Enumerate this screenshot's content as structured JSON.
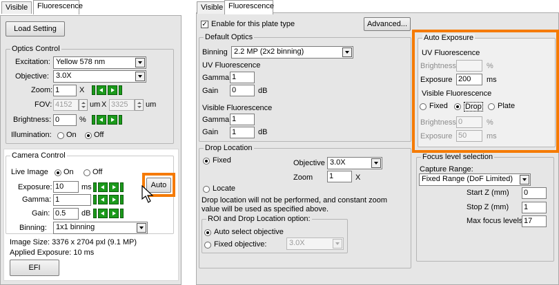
{
  "left": {
    "tabs": {
      "visible": "Visible",
      "fluorescence": "Fluorescence"
    },
    "load_setting": "Load Setting",
    "optics": {
      "title": "Optics Control",
      "excitation_label": "Excitation:",
      "excitation_value": "Yellow 578 nm",
      "objective_label": "Objective:",
      "objective_value": "3.0X",
      "zoom_label": "Zoom:",
      "zoom_value": "1",
      "zoom_unit": "X",
      "fov_label": "FOV:",
      "fov_w": "4152",
      "fov_unit1": "um",
      "fov_x": "X",
      "fov_h": "3325",
      "fov_unit2": "um",
      "brightness_label": "Brightness:",
      "brightness_value": "0",
      "brightness_unit": "%",
      "illumination_label": "Illumination:",
      "on": "On",
      "off": "Off"
    },
    "camera": {
      "title": "Camera Control",
      "live_label": "Live Image",
      "on": "On",
      "off": "Off",
      "exposure_label": "Exposure:",
      "exposure_value": "10",
      "exposure_unit": "ms",
      "auto": "Auto",
      "gamma_label": "Gamma:",
      "gamma_value": "1",
      "gain_label": "Gain:",
      "gain_value": "0.5",
      "gain_unit": "dB",
      "binning_label": "Binning:",
      "binning_value": "1x1 binning",
      "image_size": "Image Size:  3376 x 2704 pxl (9.1 MP)",
      "applied_exposure": "Applied Exposure: 10 ms",
      "efi": "EFI"
    }
  },
  "right": {
    "tabs": {
      "visible": "Visible",
      "fluorescence": "Fluorescence"
    },
    "enable_label": "Enable for this plate type",
    "advanced": "Advanced...",
    "default_optics": {
      "title": "Default Optics",
      "binning_label": "Binning",
      "binning_value": "2.2  MP (2x2 binning)",
      "uv_title": "UV Fluorescence",
      "uv_gamma_label": "Gamma",
      "uv_gamma": "1",
      "uv_gain_label": "Gain",
      "uv_gain": "0",
      "uv_gain_unit": "dB",
      "vis_title": "Visible Fluorescence",
      "vis_gamma_label": "Gamma",
      "vis_gamma": "1",
      "vis_gain_label": "Gain",
      "vis_gain": "1",
      "vis_gain_unit": "dB"
    },
    "auto_exposure": {
      "title": "Auto Exposure",
      "uv_title": "UV Fluorescence",
      "brightness_label": "Brightness",
      "brightness_unit": "%",
      "exposure_label": "Exposure",
      "exposure_value": "200",
      "exposure_unit": "ms",
      "vis_title": "Visible Fluorescence",
      "fixed": "Fixed",
      "drop": "Drop",
      "plate": "Plate",
      "vis_brightness_label": "Brightness",
      "vis_brightness": "0",
      "vis_brightness_unit": "%",
      "vis_exposure_label": "Exposure",
      "vis_exposure": "50",
      "vis_exposure_unit": "ms"
    },
    "drop_location": {
      "title": "Drop Location",
      "fixed": "Fixed",
      "objective_label": "Objective",
      "objective_value": "3.0X",
      "zoom_label": "Zoom",
      "zoom_value": "1",
      "zoom_unit": "X",
      "locate": "Locate",
      "note_line1": "Drop location will not be performed, and constant zoom",
      "note_line2": "value will be used as specified above.",
      "roi_title": "ROI and Drop Location option:",
      "auto_select": "Auto select objective",
      "fixed_objective": "Fixed objective:",
      "fixed_objective_value": "3.0X"
    },
    "focus": {
      "title": "Focus level selection",
      "capture_label": "Capture Range:",
      "capture_value": "Fixed Range (DoF Limited)",
      "start_label": "Start Z (mm)",
      "start_value": "0",
      "stop_label": "Stop Z (mm)",
      "stop_value": "1",
      "max_label": "Max focus levels",
      "max_value": "17"
    }
  },
  "colors": {
    "highlight": "#f57a00",
    "nav_green": "#1b9a1b",
    "panel": "#e6e6e6"
  }
}
